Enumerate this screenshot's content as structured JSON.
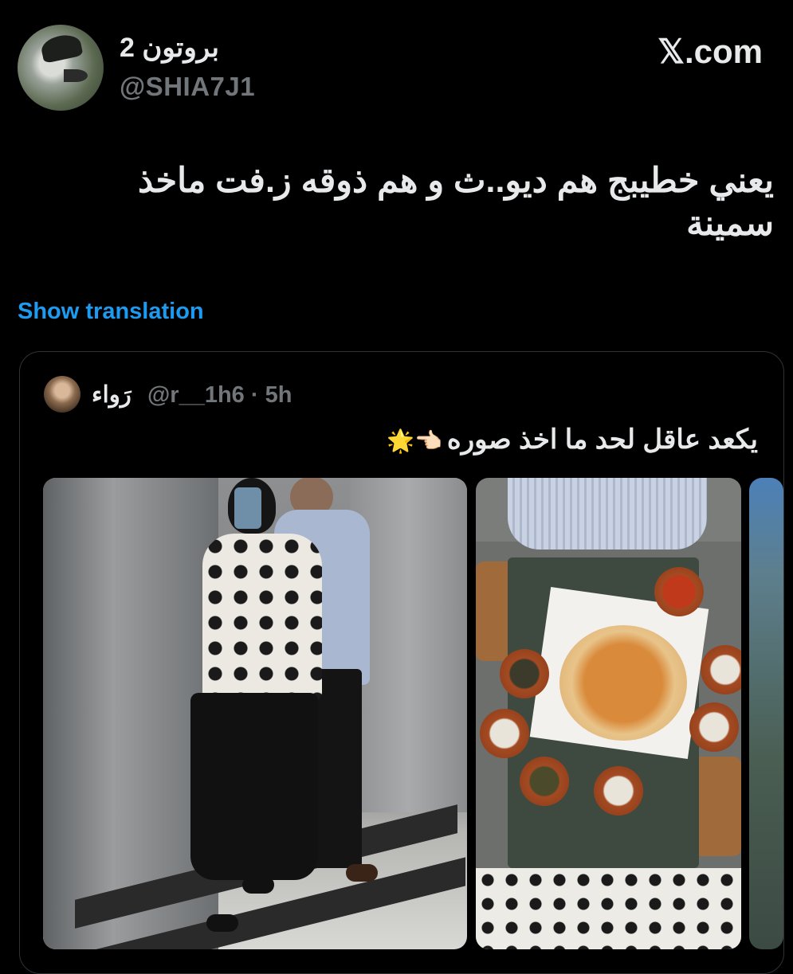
{
  "header": {
    "display_name": "بروتون 2",
    "handle": "@SHIA7J1",
    "brand": "𝕏.com"
  },
  "tweet": {
    "text": "يعني خطيبج هم ديو..ث و هم ذوقه ز.فت ماخذ سمينة",
    "show_translation": "Show translation"
  },
  "quote": {
    "author_name": "رَواء",
    "handle_time": "@r__1h6 · 5h",
    "text": "يكعد عاقل لحد ما اخذ صوره",
    "emoji": "👈🏻🌟"
  },
  "colors": {
    "background": "#000000",
    "text": "#e7e9ea",
    "secondary": "#71767b",
    "link": "#1d9bf0",
    "border": "#2f3336"
  }
}
